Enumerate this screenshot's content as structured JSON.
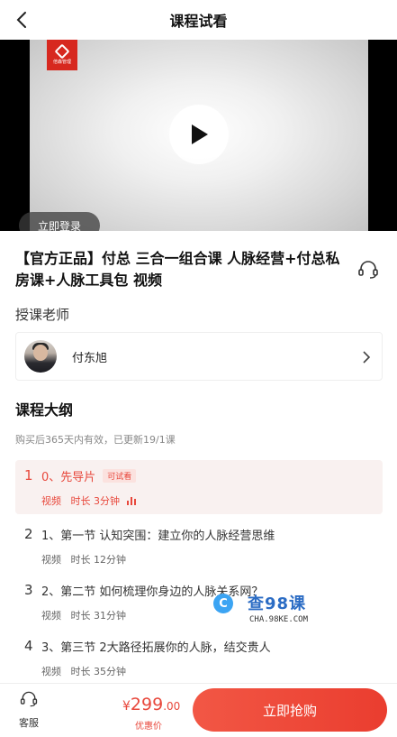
{
  "header": {
    "title": "课程试看"
  },
  "video": {
    "logo_text": "倍森管理",
    "login_button": "立即登录"
  },
  "course": {
    "title": "【官方正品】付总 三合一组合课 人脉经营+付总私房课+人脉工具包 视频"
  },
  "teacher": {
    "section_label": "授课老师",
    "name": "付东旭"
  },
  "outline": {
    "title": "课程大纲",
    "subtitle": "购买后365天内有效，已更新19/1课",
    "lessons": [
      {
        "num": "1",
        "name": "0、先导片",
        "badge": "可试看",
        "type": "视频",
        "duration": "时长 3分钟"
      },
      {
        "num": "2",
        "name": "1、第一节 认知突围：建立你的人脉经营思维",
        "type": "视频",
        "duration": "时长 12分钟"
      },
      {
        "num": "3",
        "name": "2、第二节 如何梳理你身边的人脉关系网？",
        "type": "视频",
        "duration": "时长 31分钟"
      },
      {
        "num": "4",
        "name": "3、第三节 2大路径拓展你的人脉，结交贵人",
        "type": "视频",
        "duration": "时长 35分钟"
      }
    ]
  },
  "watermark": {
    "text": "查98课",
    "url": "CHA.98KE.COM"
  },
  "bottom": {
    "service_label": "客服",
    "price_symbol": "¥",
    "price_int": "299",
    "price_dec": ".00",
    "price_tag": "优惠价",
    "buy_button": "立即抢购"
  },
  "colors": {
    "accent": "#e8483c",
    "buy_gradient_start": "#f25745",
    "buy_gradient_end": "#ea3d2f"
  }
}
